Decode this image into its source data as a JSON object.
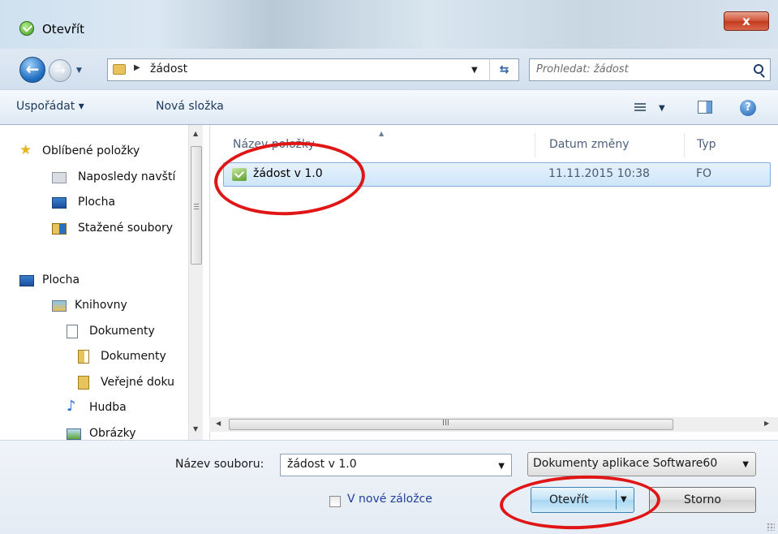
{
  "window": {
    "title": "Otevřít",
    "close_label": "x"
  },
  "address": {
    "path_item": "žádost",
    "search_placeholder": "Prohledat: žádost"
  },
  "toolbar": {
    "organize_label": "Uspořádat ▾",
    "new_folder_label": "Nová složka"
  },
  "nav": {
    "items": [
      {
        "label": "Oblíbené položky",
        "icon": "star-icon"
      },
      {
        "label": "Naposledy navští",
        "icon": "recent-places-icon"
      },
      {
        "label": "Plocha",
        "icon": "desktop-icon"
      },
      {
        "label": "Stažené soubory",
        "icon": "downloads-icon"
      },
      {
        "label": "Plocha",
        "icon": "desktop-icon"
      },
      {
        "label": "Knihovny",
        "icon": "libraries-icon"
      },
      {
        "label": "Dokumenty",
        "icon": "documents-icon"
      },
      {
        "label": "Dokumenty",
        "icon": "folder-icon"
      },
      {
        "label": "Veřejné doku",
        "icon": "folder-icon"
      },
      {
        "label": "Hudba",
        "icon": "music-icon"
      },
      {
        "label": "Obrázky",
        "icon": "pictures-icon"
      }
    ]
  },
  "filelist": {
    "columns": [
      "Název položky",
      "Datum změny",
      "Typ"
    ],
    "rows": [
      {
        "name": "žádost v 1.0",
        "date": "11.11.2015 10:38",
        "type": "FO"
      }
    ],
    "hscroll_grip": "III"
  },
  "bottom": {
    "filename_label": "Název souboru:",
    "filename_value": "žádost v 1.0",
    "filetype_value": "Dokumenty aplikace Software60",
    "new_tab_label": "V nové záložce",
    "open_label": "Otevřít",
    "cancel_label": "Storno"
  },
  "colors": {
    "annotation": "#e01515",
    "selection": "#cde5fa"
  }
}
